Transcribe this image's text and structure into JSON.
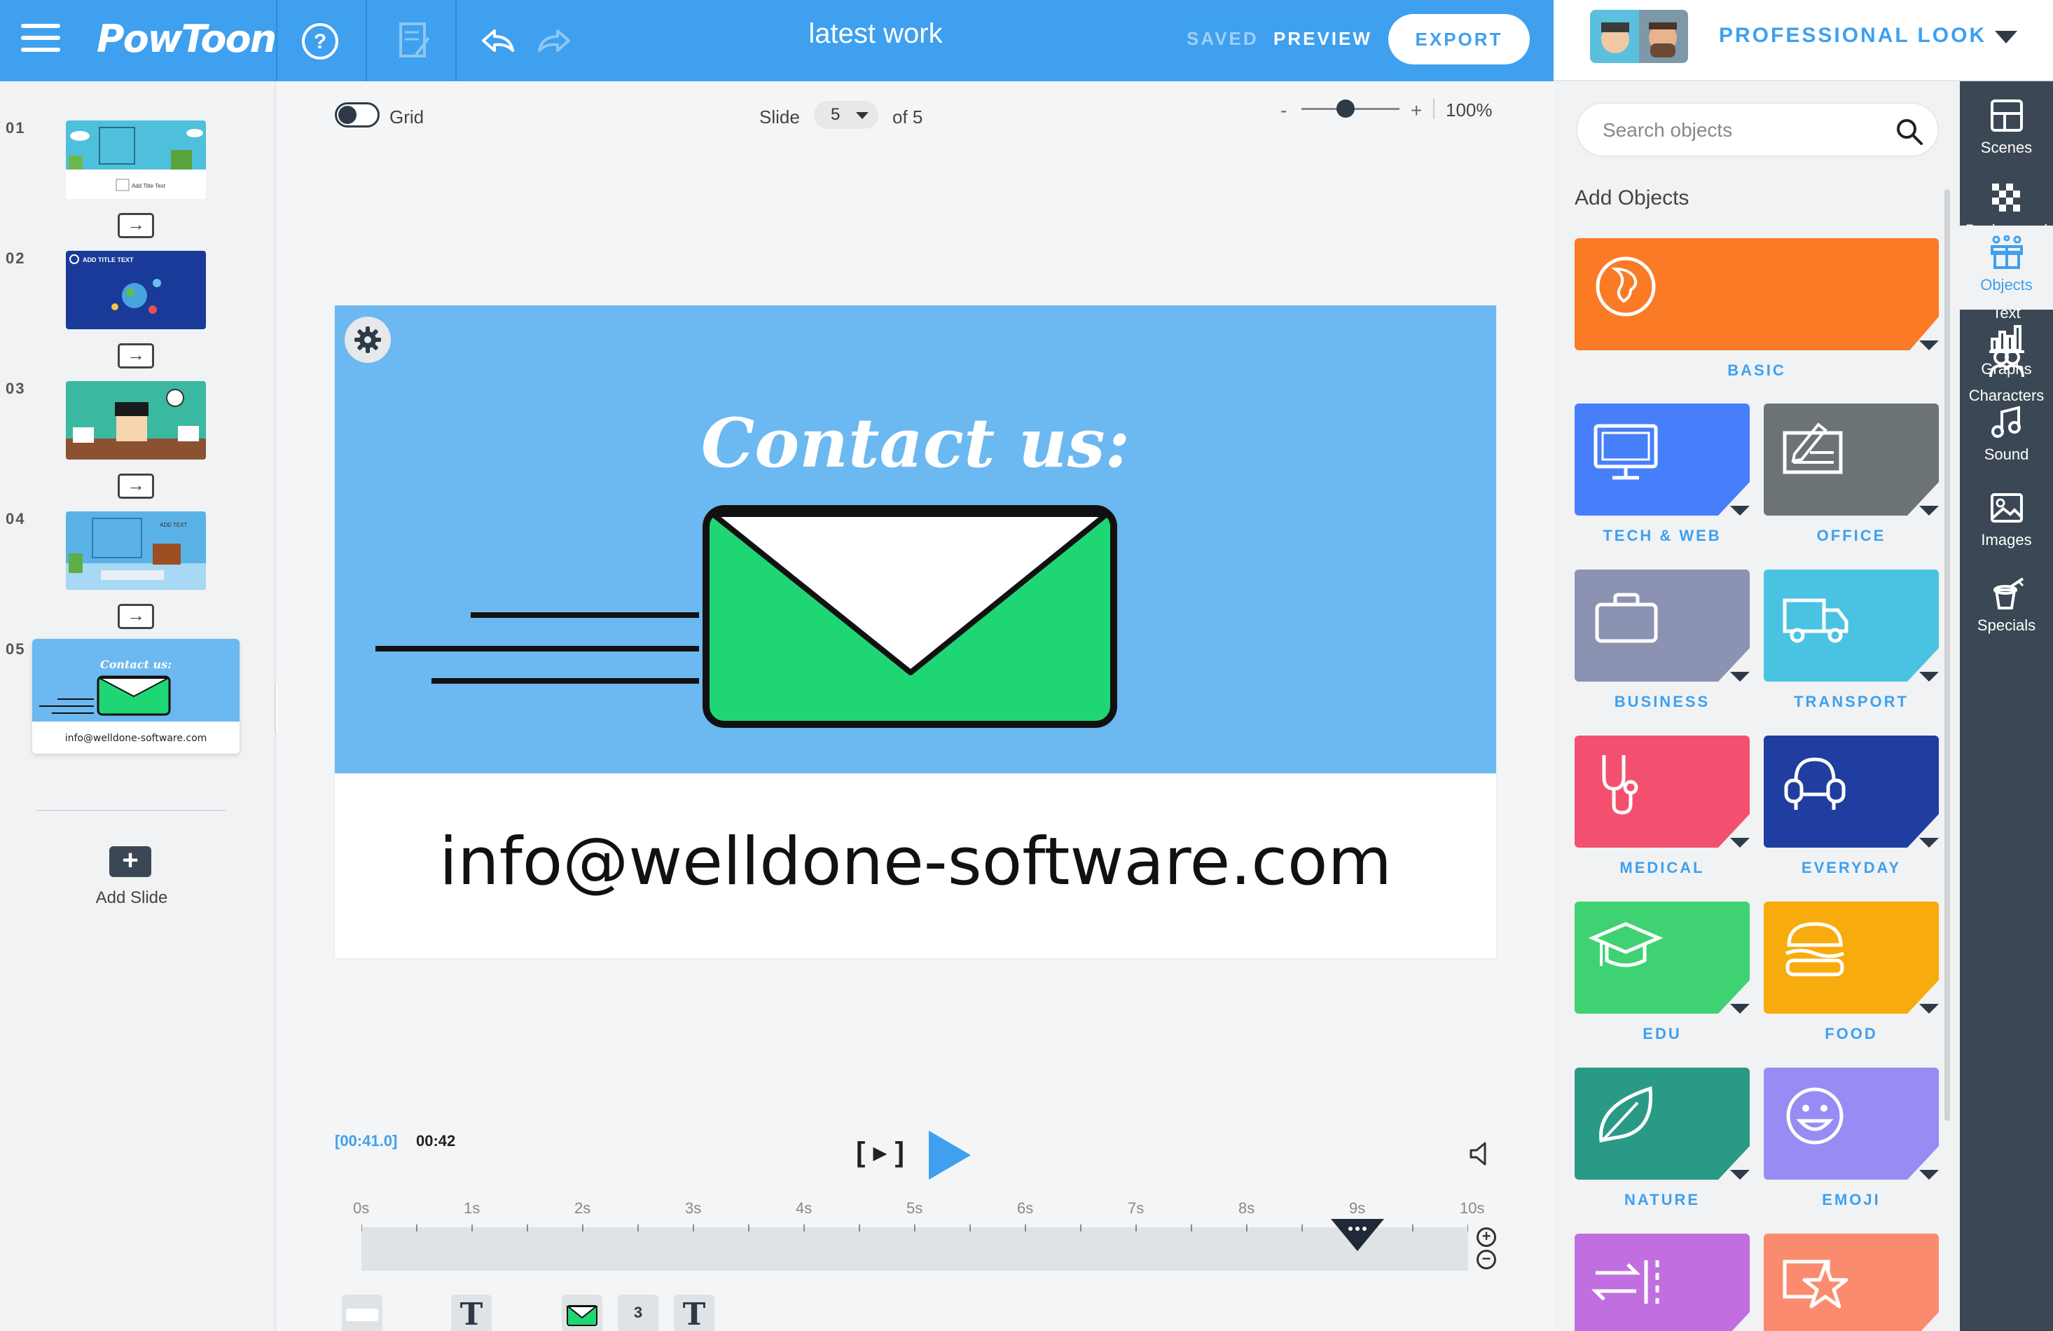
{
  "app": {
    "logo_text": "PowToon",
    "project_title": "latest work",
    "saved_label": "SAVED",
    "preview_label": "PREVIEW",
    "export_label": "EXPORT"
  },
  "style": {
    "label": "PROFESSIONAL LOOK"
  },
  "slides": {
    "numbers": [
      "01",
      "02",
      "03",
      "04",
      "05"
    ],
    "thumb_texts": {
      "s1": "Add Title Text",
      "s2": "ADD TITLE TEXT",
      "s4": "ADD TEXT",
      "s5_title": "Contact us:",
      "s5_email": "info@welldone-software.com"
    },
    "add_slide_label": "Add Slide"
  },
  "canvas": {
    "grid_label": "Grid",
    "slide_label": "Slide",
    "slide_current": "5",
    "slide_of": "of 5",
    "zoom_minus": "-",
    "zoom_plus": "+",
    "zoom_value": "100%",
    "zoom_level_percent": 100
  },
  "stage": {
    "title": "Contact us:",
    "email": "info@welldone-software.com"
  },
  "timeline": {
    "current_time": "[00:41.0]",
    "total_time": "00:42",
    "frame_label": "[ ▸ ]",
    "ticks": [
      "0s",
      "1s",
      "2s",
      "3s",
      "4s",
      "5s",
      "6s",
      "7s",
      "8s",
      "9s",
      "10s"
    ],
    "playhead_seconds": 9.0,
    "objects": [
      "",
      "T",
      "",
      "3",
      "T"
    ],
    "zoom_in": "+",
    "zoom_out": "−"
  },
  "objects_panel": {
    "search_placeholder": "Search objects",
    "title": "Add Objects",
    "categories": [
      {
        "label": "BASIC",
        "color": "#fb7a26",
        "icon": "globe-icon"
      },
      {
        "label": "TECH & WEB",
        "color": "#477ffa",
        "icon": "monitor-icon"
      },
      {
        "label": "OFFICE",
        "color": "#6b7377",
        "icon": "document-pen-icon"
      },
      {
        "label": "BUSINESS",
        "color": "#8c92b2",
        "icon": "briefcase-icon"
      },
      {
        "label": "TRANSPORT",
        "color": "#4ac3e2",
        "icon": "truck-icon"
      },
      {
        "label": "MEDICAL",
        "color": "#f3506f",
        "icon": "stethoscope-icon"
      },
      {
        "label": "EVERYDAY",
        "color": "#203da0",
        "icon": "armchair-icon"
      },
      {
        "label": "EDU",
        "color": "#3fd272",
        "icon": "graduation-cap-icon"
      },
      {
        "label": "FOOD",
        "color": "#f8ab0c",
        "icon": "burger-icon"
      },
      {
        "label": "NATURE",
        "color": "#2a9a86",
        "icon": "leaf-icon"
      },
      {
        "label": "EMOJI",
        "color": "#978cf4",
        "icon": "smiley-icon"
      },
      {
        "label": "",
        "color": "#c16fe0",
        "icon": "arrows-icon"
      },
      {
        "label": "",
        "color": "#fb8b6e",
        "icon": "star-icon"
      }
    ]
  },
  "side_nav": [
    {
      "label": "Scenes",
      "icon": "scenes-icon"
    },
    {
      "label": "Background",
      "icon": "background-icon"
    },
    {
      "label": "Text",
      "icon": "text-icon"
    },
    {
      "label": "Characters",
      "icon": "characters-icon"
    },
    {
      "label": "Objects",
      "icon": "objects-icon",
      "active": true
    },
    {
      "label": "Graphs",
      "icon": "graphs-icon"
    },
    {
      "label": "Sound",
      "icon": "sound-icon"
    },
    {
      "label": "Images",
      "icon": "images-icon"
    },
    {
      "label": "Specials",
      "icon": "specials-icon"
    }
  ],
  "colors": {
    "brand_blue": "#3ea0ef",
    "dark": "#3b4755",
    "envelope_green": "#1fd675",
    "stage_blue": "#6cb8f0"
  }
}
